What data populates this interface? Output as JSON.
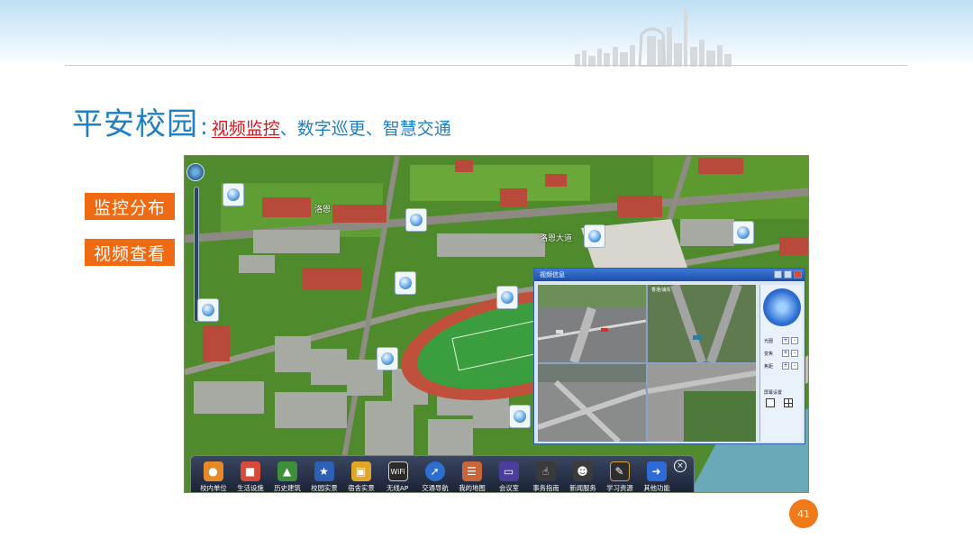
{
  "title": {
    "main": "平安校园",
    "separator": ":",
    "active_item": "视频监控",
    "rest": "、数字巡更、智慧交通"
  },
  "side_buttons": [
    {
      "label": "监控分布"
    },
    {
      "label": "视频查看"
    }
  ],
  "map": {
    "road_labels": [
      {
        "text": "洛恩",
        "id": "r1"
      },
      {
        "text": "洛恩大道",
        "id": "r2"
      }
    ]
  },
  "video_window": {
    "title": "视频信息",
    "feed_stamps": [
      "",
      "香港/浦东",
      "",
      ""
    ],
    "ptz": {
      "rows": [
        {
          "label": "光圈"
        },
        {
          "label": "变焦"
        },
        {
          "label": "焦距"
        }
      ],
      "plus": "+",
      "minus": "-",
      "split_label": "屏幕设置"
    }
  },
  "toolbar": {
    "items": [
      {
        "label": "校内单位",
        "icon": "people-icon",
        "color": "#e58a2b"
      },
      {
        "label": "生活设施",
        "icon": "store-icon",
        "color": "#d64a3a"
      },
      {
        "label": "历史建筑",
        "icon": "tree-icon",
        "color": "#3d8f3a"
      },
      {
        "label": "校园实景",
        "icon": "badge-icon",
        "color": "#2d5fb5"
      },
      {
        "label": "宿舍实景",
        "icon": "photo-icon",
        "color": "#e0a62a"
      },
      {
        "label": "无线AP",
        "icon": "wifi-icon",
        "color": "#2b2b2b"
      },
      {
        "label": "交通导航",
        "icon": "compass-icon",
        "color": "#2d6fd1"
      },
      {
        "label": "我的地图",
        "icon": "map-icon",
        "color": "#c9653b"
      },
      {
        "label": "会议室",
        "icon": "monitor-icon",
        "color": "#4a3d9b"
      },
      {
        "label": "事务指南",
        "icon": "hand-pointer-icon",
        "color": "#3a3a3a"
      },
      {
        "label": "新闻服务",
        "icon": "person-icon",
        "color": "#3b3b3b"
      },
      {
        "label": "学习资源",
        "icon": "chalkboard-icon",
        "color": "#2e2e2e"
      },
      {
        "label": "其他功能",
        "icon": "arrow-right-icon",
        "color": "#2f6bd6"
      }
    ],
    "close_glyph": "×"
  },
  "page": {
    "number": "41"
  },
  "colors": {
    "title_blue": "#1d7fc4",
    "active_red": "#d9141b",
    "button_orange": "#ef6a12"
  }
}
